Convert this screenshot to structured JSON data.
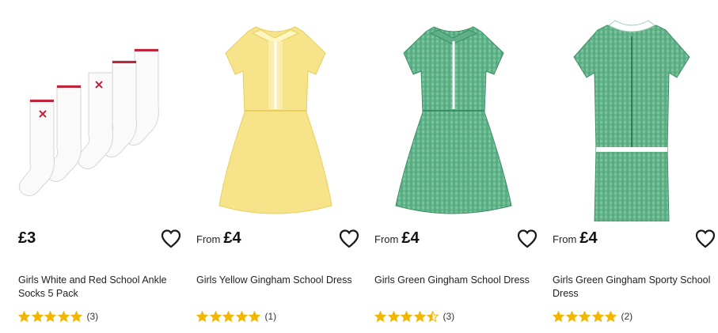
{
  "products": [
    {
      "name": "Girls White and Red School Ankle Socks 5 Pack",
      "price_prefix": "",
      "price": "£3",
      "rating": 5,
      "review_count": "(3)",
      "image": "socks"
    },
    {
      "name": "Girls Yellow Gingham School Dress",
      "price_prefix": "From",
      "price": "£4",
      "rating": 5,
      "review_count": "(1)",
      "image": "yellow-dress"
    },
    {
      "name": "Girls Green Gingham School Dress",
      "price_prefix": "From",
      "price": "£4",
      "rating": 4.5,
      "review_count": "(3)",
      "image": "green-dress"
    },
    {
      "name": "Girls Green Gingham Sporty School Dress",
      "price_prefix": "From",
      "price": "£4",
      "rating": 5,
      "review_count": "(2)",
      "image": "green-sporty-dress"
    }
  ],
  "icons": {
    "wishlist": "heart-outline-icon",
    "rating": "star-icon"
  },
  "colors": {
    "star": "#f2b705",
    "yellow_dress": "#f7e48a",
    "green_dress": "#4fa77c",
    "heart_stroke": "#1a1a1a"
  }
}
